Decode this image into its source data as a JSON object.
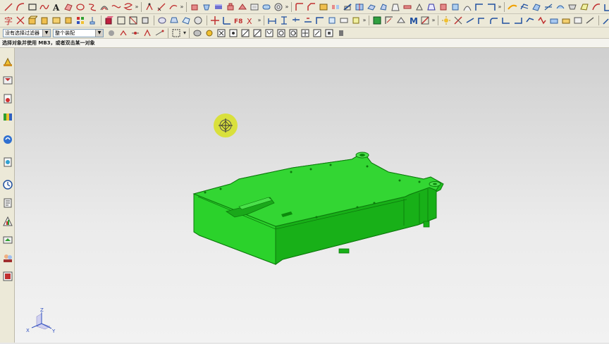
{
  "filters": {
    "type_filter": "没有选择过滤器",
    "scope_filter": "整个装配"
  },
  "cue_line": "选择对象并使用 MB3，或者双击某一对象",
  "triad": {
    "x_label": "X",
    "y_label": "Y",
    "z_label": "Z"
  },
  "colors": {
    "part_green": "#20c020",
    "part_dark": "#0c8a0c",
    "part_light": "#4be04b",
    "cursor_highlight": "#d8e02a",
    "toolbar_bg": "#ece9d8"
  }
}
